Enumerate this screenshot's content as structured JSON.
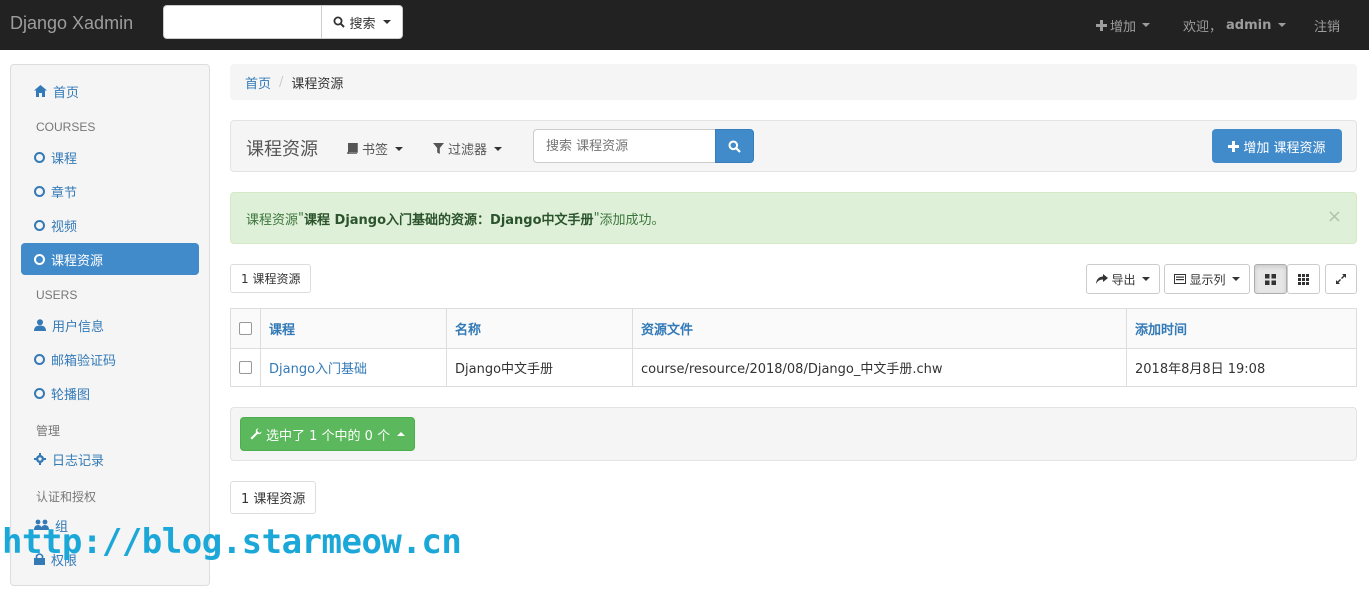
{
  "navbar": {
    "brand": "Django Xadmin",
    "search_button": "搜索",
    "add_label": "增加",
    "welcome_label": "欢迎，",
    "user_name": "admin",
    "logout_label": "注销"
  },
  "sidebar": {
    "home": "首页",
    "sections": [
      {
        "heading": "COURSES",
        "items": [
          "课程",
          "章节",
          "视频",
          "课程资源"
        ]
      },
      {
        "heading": "USERS",
        "items": [
          "用户信息",
          "邮箱验证码",
          "轮播图"
        ]
      },
      {
        "heading": "管理",
        "items": [
          "日志记录"
        ]
      },
      {
        "heading": "认证和授权",
        "items": [
          "组",
          "权限"
        ]
      }
    ],
    "active_item": "课程资源"
  },
  "breadcrumb": {
    "home": "首页",
    "separator": "/",
    "current": "课程资源"
  },
  "toolbar": {
    "title": "课程资源",
    "bookmarks_label": "书签",
    "filters_label": "过滤器",
    "search_placeholder": "搜索 课程资源",
    "add_button_label": "增加 课程资源"
  },
  "alert": {
    "prefix": "课程资源",
    "open_quote": " \"",
    "object_text": "课程 Django入门基础的资源：Django中文手册",
    "close_quote": "\"",
    "suffix": " 添加成功。",
    "close_symbol": "×"
  },
  "results": {
    "count_label": "1 课程资源",
    "export_label": "导出",
    "columns_label": "显示列"
  },
  "table": {
    "headers": [
      "课程",
      "名称",
      "资源文件",
      "添加时间"
    ],
    "rows": [
      {
        "course": "Django入门基础",
        "name": "Django中文手册",
        "file": "course/resource/2018/08/Django_中文手册.chw",
        "added": "2018年8月8日 19:08"
      }
    ]
  },
  "actions": {
    "selected_label": "选中了 1 个中的 0 个"
  },
  "footer": {
    "count_label": "1 课程资源"
  },
  "watermark": "http://blog.starmeow.cn",
  "colors": {
    "navbar_bg": "#222222",
    "link": "#337ab7",
    "primary": "#428bca",
    "success": "#5cb85c",
    "alert_bg": "#dff0d8",
    "watermark": "#1ba8d8"
  }
}
